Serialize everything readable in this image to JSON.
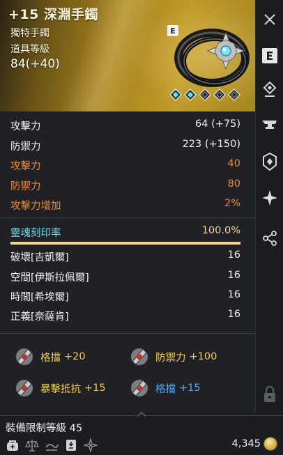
{
  "header": {
    "title": "+15 深淵手鐲",
    "item_type": "獨特手鐲",
    "level_label": "道具等級",
    "level_value": "84(+40)",
    "badge": "E",
    "icon": "bracelet-icon",
    "slots": [
      "filled-diamond",
      "filled-diamond",
      "empty-diamond",
      "empty-diamond",
      "empty-diamond"
    ]
  },
  "stats": {
    "basic": [
      {
        "label": "攻擊力",
        "value": "64 (+75)"
      },
      {
        "label": "防禦力",
        "value": "223 (+150)"
      }
    ],
    "bonus": [
      {
        "label": "攻擊力",
        "value": "40"
      },
      {
        "label": "防禦力",
        "value": "80"
      },
      {
        "label": "攻擊力增加",
        "value": "2%"
      }
    ],
    "soul": {
      "label": "靈魂刻印率",
      "value": "100.0%",
      "fill": 1.0
    },
    "enchant": [
      {
        "label": "破壞[吉凱爾]",
        "value": "16"
      },
      {
        "label": "空間[伊斯拉佩爾]",
        "value": "16"
      },
      {
        "label": "時間[希埃爾]",
        "value": "16"
      },
      {
        "label": "正義[奈薩肯]",
        "value": "16"
      }
    ]
  },
  "effects": [
    {
      "name": "格擋",
      "value": "+20"
    },
    {
      "name": "防禦力",
      "value": "+100"
    },
    {
      "name": "暴擊抵抗",
      "value": "+15"
    },
    {
      "name": "格擋",
      "value": "+15"
    }
  ],
  "footer": {
    "requirement": "裝備限制等級 45",
    "price": "4,345",
    "icons": [
      "bag-icon",
      "scale-icon",
      "wind-icon",
      "card-icon",
      "compass-icon"
    ]
  },
  "sidebar": {
    "icons": [
      "close-icon",
      "e-key-icon",
      "rune-icon",
      "anvil-icon",
      "crest-icon",
      "star-icon",
      "share-icon",
      "lock-icon"
    ]
  },
  "colors": {
    "header_gold": "#b58d22",
    "bonus_orange": "#ee8a37",
    "cyan": "#74d8df",
    "effect_gold": "#f2c94c",
    "effect_blue": "#58a8ef",
    "soul_bar": "#f3d48a"
  }
}
